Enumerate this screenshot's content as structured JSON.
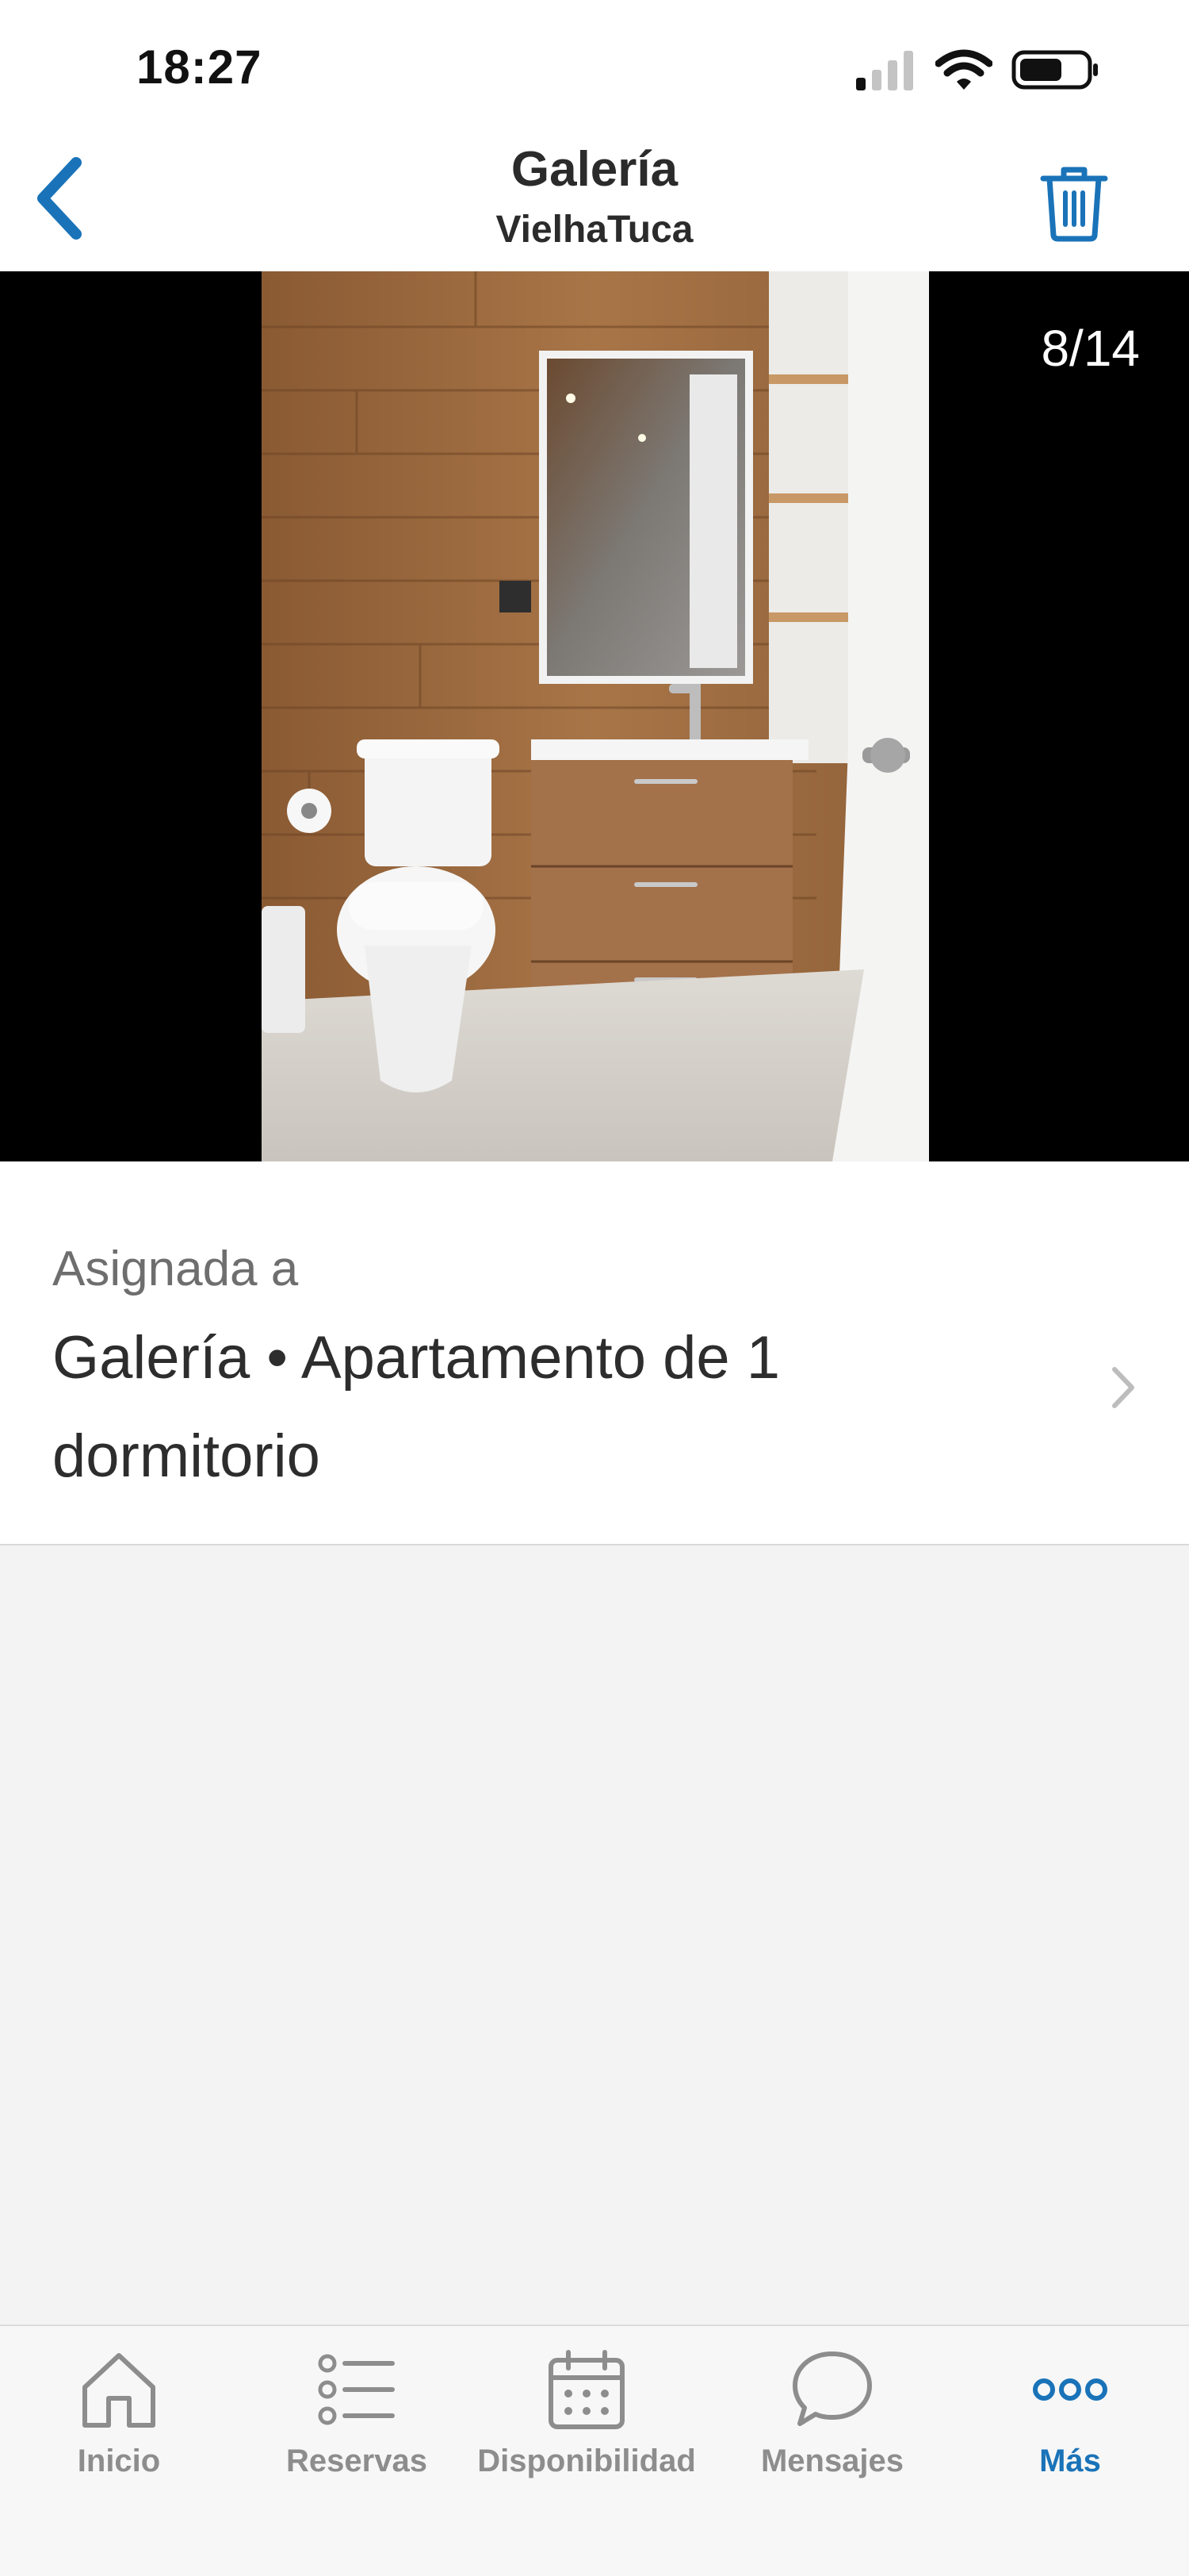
{
  "status_bar": {
    "time": "18:27"
  },
  "header": {
    "title": "Galería",
    "subtitle": "VielhaTuca"
  },
  "viewer": {
    "counter": "8/14"
  },
  "assignment": {
    "label": "Asignada a",
    "value": "Galería • Apartamento de 1 dormitorio"
  },
  "tabbar": {
    "tabs": [
      {
        "label": "Inicio",
        "icon": "home-icon",
        "active": false
      },
      {
        "label": "Reservas",
        "icon": "list-icon",
        "active": false
      },
      {
        "label": "Disponibilidad",
        "icon": "calendar-icon",
        "active": false
      },
      {
        "label": "Mensajes",
        "icon": "chat-icon",
        "active": false
      },
      {
        "label": "Más",
        "icon": "more-icon",
        "active": true
      }
    ]
  },
  "colors": {
    "accent": "#1a73b8",
    "inactive": "#8d8d8d",
    "text": "#2d2d2d"
  }
}
